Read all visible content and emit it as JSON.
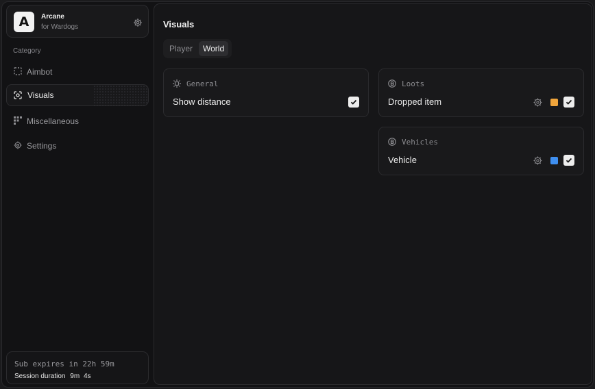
{
  "brand": {
    "logo_letter": "A",
    "name": "Arcane",
    "subtitle": "for Wardogs"
  },
  "sidebar": {
    "category_label": "Category",
    "items": [
      {
        "label": "Aimbot",
        "icon": "crosshair-dashed-icon",
        "active": false
      },
      {
        "label": "Visuals",
        "icon": "eye-scan-icon",
        "active": true
      },
      {
        "label": "Miscellaneous",
        "icon": "grid-icon",
        "active": false
      },
      {
        "label": "Settings",
        "icon": "gear-icon",
        "active": false
      }
    ]
  },
  "subscription": {
    "expires_text": "Sub expires in 22h 59m",
    "session_label": "Session duration",
    "session_minutes": "9m",
    "session_seconds": "4s"
  },
  "main": {
    "title": "Visuals",
    "tabs": [
      {
        "label": "Player",
        "active": false
      },
      {
        "label": "World",
        "active": true
      }
    ],
    "cards": {
      "general": {
        "title": "General",
        "icon": "sun-dashed-icon",
        "row_label": "Show distance",
        "checked": true
      },
      "loots": {
        "title": "Loots",
        "icon": "coin-icon",
        "row_label": "Dropped item",
        "color": "#f0a53c",
        "checked": true
      },
      "vehicles": {
        "title": "Vehicles",
        "icon": "coin-icon",
        "row_label": "Vehicle",
        "color": "#3f8ff0",
        "checked": true
      }
    }
  }
}
